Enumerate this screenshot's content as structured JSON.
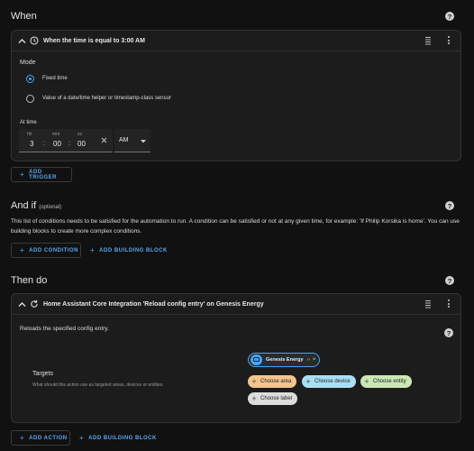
{
  "sections": {
    "when": "When",
    "and_if": "And if",
    "and_if_optional": "(optional)",
    "then_do": "Then do",
    "conditions_description": "This list of conditions needs to be satisfied for the automation to run. A condition can be satisfied or not at any given time, for example: 'If Philip Korsika is home'. You can use building blocks to create more complex conditions."
  },
  "trigger": {
    "title": "When the time is equal to 3:00 AM",
    "mode_label": "Mode",
    "options": [
      {
        "label": "Fixed time",
        "selected": true
      },
      {
        "label": "Value of a date/time helper or timestamp-class sensor",
        "selected": false
      }
    ],
    "at_time_label": "At time",
    "time": {
      "hh_label": "hh",
      "hh": "3",
      "mm_label": "mm",
      "mm": "00",
      "ss_label": "ss",
      "ss": "00",
      "ampm": "AM"
    }
  },
  "buttons": {
    "add_trigger": "ADD TRIGGER",
    "add_condition": "ADD CONDITION",
    "add_building_block": "ADD BUILDING BLOCK",
    "add_action": "ADD ACTION"
  },
  "action": {
    "title": "Home Assistant Core Integration 'Reload config entry' on Genesis Energy",
    "description": "Reloads the specified config entry.",
    "targets_label": "Targets",
    "targets_hint": "What should this action use as targeted areas, devices or entities.",
    "selected_target": "Genesis Energy",
    "chips": {
      "area": "Choose area",
      "device": "Choose device",
      "entity": "Choose entity",
      "label": "Choose label"
    }
  },
  "colors": {
    "accent": "#4aa3f0",
    "area_chip": "#f6c48e",
    "device_chip": "#a9dff5",
    "entity_chip": "#cbe7b5",
    "label_chip": "#dcdcdc"
  }
}
